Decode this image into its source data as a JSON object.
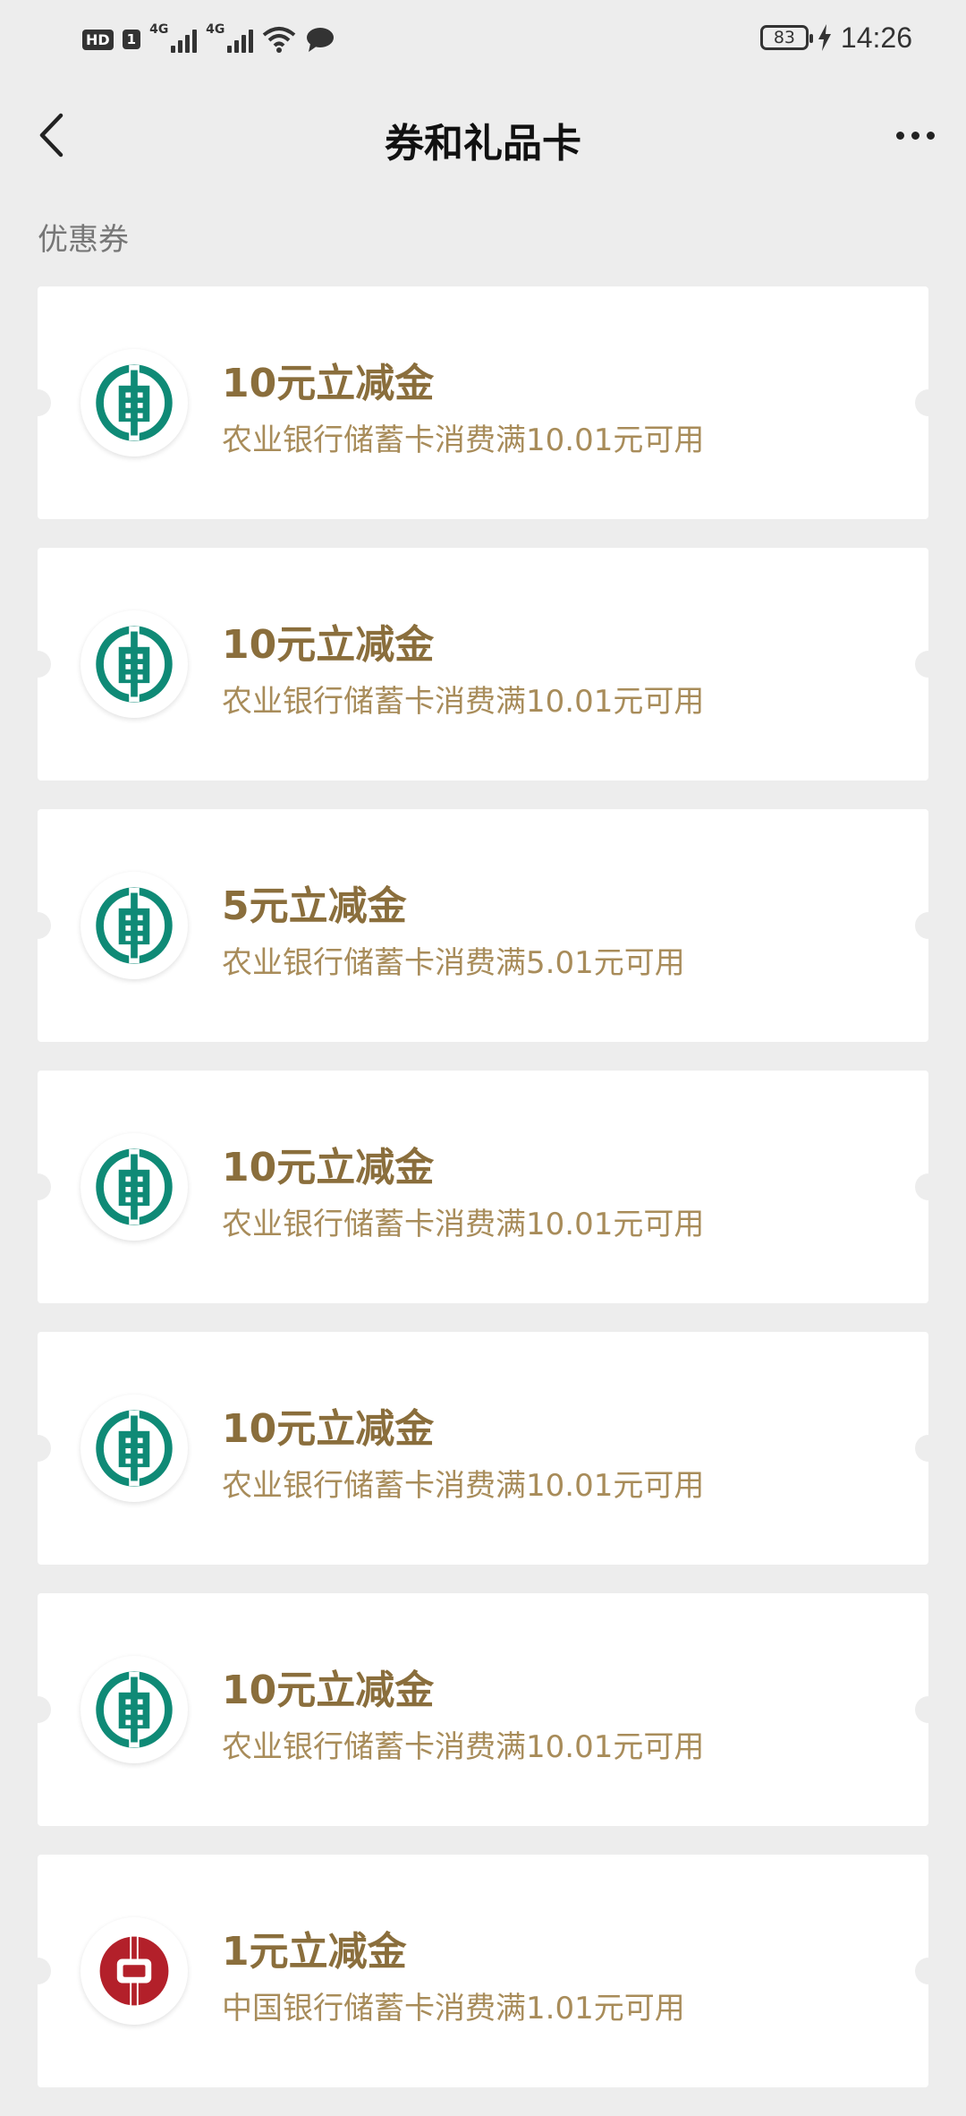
{
  "status_bar": {
    "hd": "HD",
    "sim": "1",
    "net1": "4G",
    "net2": "4G",
    "battery": "83",
    "time": "14:26"
  },
  "header": {
    "title": "券和礼品卡"
  },
  "section": {
    "label": "优惠券"
  },
  "coupons": [
    {
      "title": "10元立减金",
      "desc": "农业银行储蓄卡消费满10.01元可用",
      "bank": "abc"
    },
    {
      "title": "10元立减金",
      "desc": "农业银行储蓄卡消费满10.01元可用",
      "bank": "abc"
    },
    {
      "title": "5元立减金",
      "desc": "农业银行储蓄卡消费满5.01元可用",
      "bank": "abc"
    },
    {
      "title": "10元立减金",
      "desc": "农业银行储蓄卡消费满10.01元可用",
      "bank": "abc"
    },
    {
      "title": "10元立减金",
      "desc": "农业银行储蓄卡消费满10.01元可用",
      "bank": "abc"
    },
    {
      "title": "10元立减金",
      "desc": "农业银行储蓄卡消费满10.01元可用",
      "bank": "abc"
    },
    {
      "title": "1元立减金",
      "desc": "中国银行储蓄卡消费满1.01元可用",
      "bank": "boc"
    }
  ],
  "colors": {
    "abc_green": "#0f8a76",
    "boc_red": "#b3202a",
    "title_gold": "#8a6e3c",
    "desc_gold": "#a88c5a"
  },
  "icons": {
    "back": "chevron-left-icon",
    "more": "more-dots-icon",
    "abc_logo": "agricultural-bank-logo",
    "boc_logo": "bank-of-china-logo"
  }
}
